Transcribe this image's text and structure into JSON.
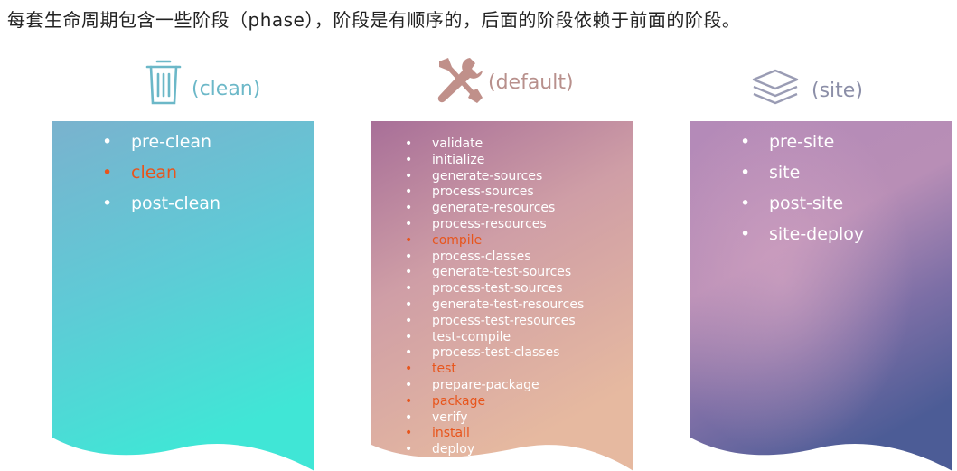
{
  "heading": "每套生命周期包含一些阶段（phase），阶段是有顺序的，后面的阶段依赖于前面的阶段。",
  "colors": {
    "highlight": "#e8551c",
    "clean_label": "#6cb8c8",
    "default_label": "#b8908c",
    "site_label": "#8c8fa8"
  },
  "lifecycles": [
    {
      "label": "(clean)",
      "icon": "trash-icon",
      "phases": [
        {
          "name": "pre-clean",
          "highlight": false
        },
        {
          "name": "clean",
          "highlight": true
        },
        {
          "name": "post-clean",
          "highlight": false
        }
      ]
    },
    {
      "label": "(default)",
      "icon": "tools-icon",
      "phases": [
        {
          "name": "validate",
          "highlight": false
        },
        {
          "name": "initialize",
          "highlight": false
        },
        {
          "name": "generate-sources",
          "highlight": false
        },
        {
          "name": "process-sources",
          "highlight": false
        },
        {
          "name": "generate-resources",
          "highlight": false
        },
        {
          "name": "process-resources",
          "highlight": false
        },
        {
          "name": "compile",
          "highlight": true
        },
        {
          "name": "process-classes",
          "highlight": false
        },
        {
          "name": "generate-test-sources",
          "highlight": false
        },
        {
          "name": "process-test-sources",
          "highlight": false
        },
        {
          "name": "generate-test-resources",
          "highlight": false
        },
        {
          "name": "process-test-resources",
          "highlight": false
        },
        {
          "name": "test-compile",
          "highlight": false
        },
        {
          "name": "process-test-classes",
          "highlight": false
        },
        {
          "name": "test",
          "highlight": true
        },
        {
          "name": "prepare-package",
          "highlight": false
        },
        {
          "name": "package",
          "highlight": true
        },
        {
          "name": "verify",
          "highlight": false
        },
        {
          "name": "install",
          "highlight": true
        },
        {
          "name": "deploy",
          "highlight": false
        }
      ]
    },
    {
      "label": "(site)",
      "icon": "layers-icon",
      "phases": [
        {
          "name": "pre-site",
          "highlight": false
        },
        {
          "name": "site",
          "highlight": false
        },
        {
          "name": "post-site",
          "highlight": false
        },
        {
          "name": "site-deploy",
          "highlight": false
        }
      ]
    }
  ]
}
